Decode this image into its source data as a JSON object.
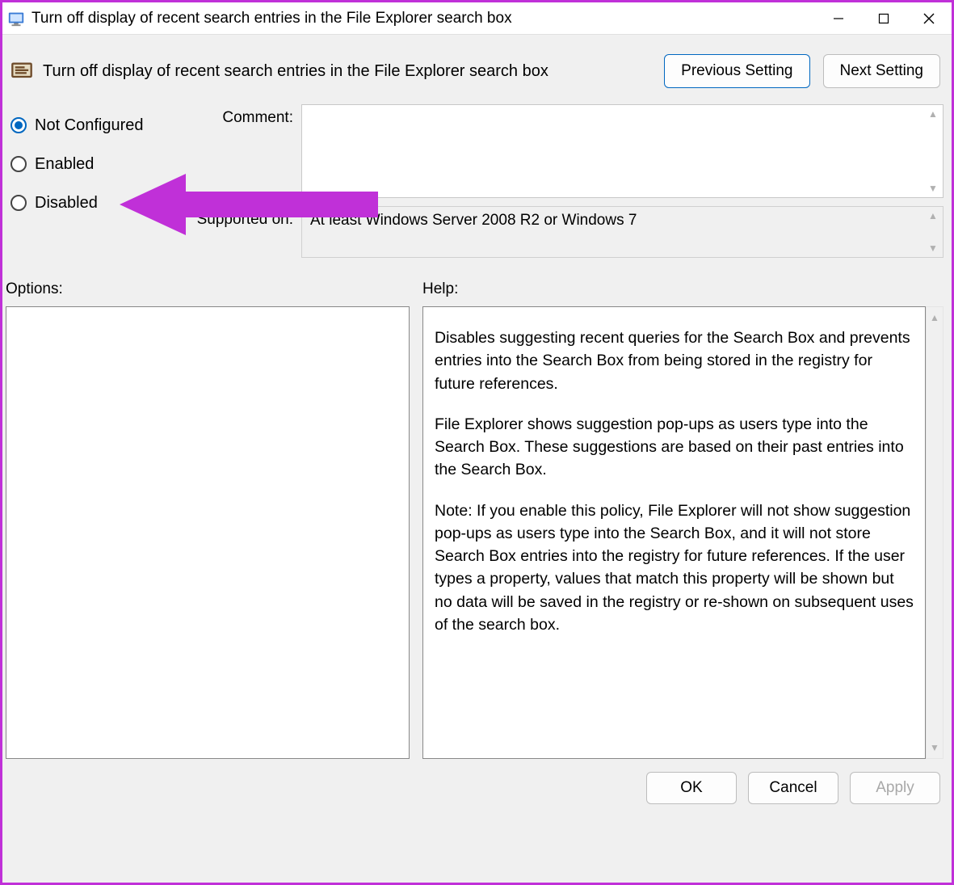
{
  "window": {
    "title": "Turn off display of recent search entries in the File Explorer search box"
  },
  "header": {
    "policy_title": "Turn off display of recent search entries in the File Explorer search box",
    "nav": {
      "prev": "Previous Setting",
      "next": "Next Setting"
    }
  },
  "radios": {
    "not_configured": "Not Configured",
    "enabled": "Enabled",
    "disabled": "Disabled",
    "selected": "not_configured"
  },
  "fields": {
    "comment_label": "Comment:",
    "comment_value": "",
    "supported_label": "Supported on:",
    "supported_value": "At least Windows Server 2008 R2 or Windows 7"
  },
  "sections": {
    "options_label": "Options:",
    "help_label": "Help:"
  },
  "help": {
    "p1": "Disables suggesting recent queries for the Search Box and prevents entries into the Search Box from being stored in the registry for future references.",
    "p2": "File Explorer shows suggestion pop-ups as users type into the Search Box.  These suggestions are based on their past entries into the Search Box.",
    "p3": "Note: If you enable this policy, File Explorer will not show suggestion pop-ups as users type into the Search Box, and it will not store Search Box entries into the registry for future references.  If the user types a property, values that match this property will be shown but no data will be saved in the registry or re-shown on subsequent uses of the search box."
  },
  "footer": {
    "ok": "OK",
    "cancel": "Cancel",
    "apply": "Apply"
  },
  "annotation": {
    "arrow_color": "#c030d8"
  }
}
